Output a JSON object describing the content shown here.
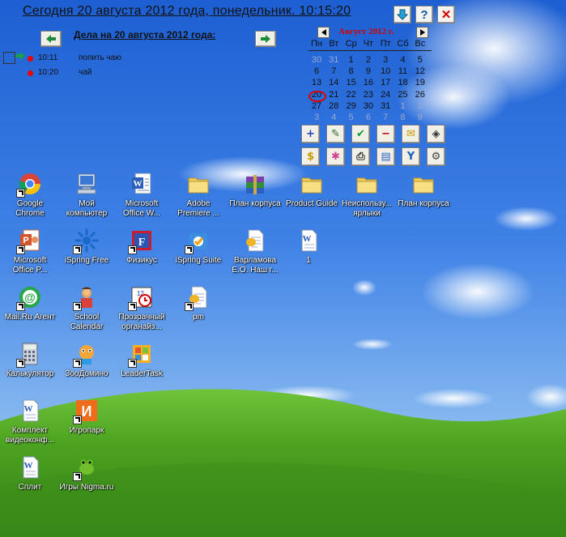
{
  "header": {
    "title": "Сегодня 20 августа 2012 года, понедельник. 10:15:20",
    "help_label": "?",
    "close_label": "✕"
  },
  "tasks": {
    "title": "Дела на  20 августа 2012 года:",
    "items": [
      {
        "time": "10:11",
        "text": "попить чаю"
      },
      {
        "time": "10:20",
        "text": "чай"
      }
    ]
  },
  "calendar": {
    "month_label": "Август 2012 г.",
    "weekdays": [
      "Пн",
      "Вт",
      "Ср",
      "Чт",
      "Пт",
      "Сб",
      "Вс"
    ],
    "weeks": [
      [
        "30",
        "31",
        "1",
        "2",
        "3",
        "4",
        "5"
      ],
      [
        "6",
        "7",
        "8",
        "9",
        "10",
        "11",
        "12"
      ],
      [
        "13",
        "14",
        "15",
        "16",
        "17",
        "18",
        "19"
      ],
      [
        "20",
        "21",
        "22",
        "23",
        "24",
        "25",
        "26"
      ],
      [
        "27",
        "28",
        "29",
        "30",
        "31",
        "1",
        "2"
      ],
      [
        "3",
        "4",
        "5",
        "6",
        "7",
        "8",
        "9"
      ]
    ],
    "today": "20",
    "accent_color": "#d40000"
  },
  "toolbar": {
    "buttons": [
      {
        "icon": "plus-icon",
        "glyph": "+"
      },
      {
        "icon": "edit-icon",
        "glyph": "✎"
      },
      {
        "icon": "check-icon",
        "glyph": "✔"
      },
      {
        "icon": "minus-icon",
        "glyph": "−"
      },
      {
        "icon": "mail-icon",
        "glyph": "✉"
      },
      {
        "icon": "eraser-icon",
        "glyph": "◈"
      },
      {
        "icon": "money-icon",
        "glyph": "$"
      },
      {
        "icon": "burst-icon",
        "glyph": "✱"
      },
      {
        "icon": "printer-icon",
        "glyph": "⎙"
      },
      {
        "icon": "notes-icon",
        "glyph": "▤"
      },
      {
        "icon": "tools-icon",
        "glyph": "Y"
      },
      {
        "icon": "settings-icon",
        "glyph": "⚙"
      }
    ]
  },
  "desktop": {
    "icons": [
      {
        "name": "google-chrome",
        "label": "Google Chrome",
        "type": "chrome"
      },
      {
        "name": "my-computer",
        "label": "Мой компьютер",
        "type": "computer"
      },
      {
        "name": "ms-office-word",
        "label": "Microsoft Office W...",
        "type": "word"
      },
      {
        "name": "adobe-premiere",
        "label": "Adobe Premiere ...",
        "type": "folder"
      },
      {
        "name": "plan-korpusa-archive",
        "label": "План корпуса",
        "type": "archive"
      },
      {
        "name": "product-guide",
        "label": "Product Guide",
        "type": "folder"
      },
      {
        "name": "unused-shortcuts",
        "label": "Неиспользу... ярлыки",
        "type": "folder"
      },
      {
        "name": "plan-korpusa-folder",
        "label": "План корпуса",
        "type": "folder"
      },
      {
        "name": "ms-office-powerpoint",
        "label": "Microsoft Office P...",
        "type": "ppt"
      },
      {
        "name": "ispring-free",
        "label": "iSpring Free",
        "type": "ispring"
      },
      {
        "name": "fizikus",
        "label": "Физикус",
        "type": "fizikus"
      },
      {
        "name": "ispring-suite",
        "label": "iSpring Suite",
        "type": "suite"
      },
      {
        "name": "varlamova-doc",
        "label": "Варламова Е.О. Наш г...",
        "type": "doc"
      },
      {
        "name": "doc-1",
        "label": "1",
        "type": "word-doc"
      },
      {
        "name": "mailru-agent",
        "label": "Mail.Ru Агент",
        "type": "mailru"
      },
      {
        "name": "school-calendar",
        "label": "School Calendar",
        "type": "calendar"
      },
      {
        "name": "prozrachny-organizer",
        "label": "Прозрачный органайз...",
        "type": "organizer"
      },
      {
        "name": "pm",
        "label": "pm",
        "type": "doc"
      },
      {
        "name": "calculator",
        "label": "Калькулятор",
        "type": "calc"
      },
      {
        "name": "zoodomino",
        "label": "ЗооДомино",
        "type": "zoo"
      },
      {
        "name": "leadertask",
        "label": "LeaderTask",
        "type": "leadertask"
      },
      {
        "name": "komplekt",
        "label": "Комплект видеоконф...",
        "type": "word-doc"
      },
      {
        "name": "igropark",
        "label": "Игропарк",
        "type": "igropark"
      },
      {
        "name": "split",
        "label": "Сплит",
        "type": "word-doc"
      },
      {
        "name": "igry-nigma",
        "label": "Игры Nigma.ru",
        "type": "nigma"
      }
    ]
  }
}
